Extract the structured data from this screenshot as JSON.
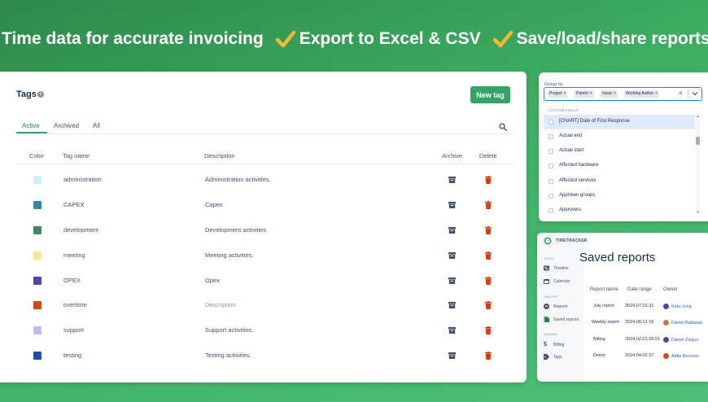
{
  "headline": {
    "item1": "Time data for accurate invoicing",
    "item2": "Export to Excel & CSV",
    "item3": "Save/load/share reports"
  },
  "colors": {
    "accent": "#36a466",
    "check": "#f5b82e",
    "delete": "#de350b",
    "archive": "#42526e"
  },
  "tags": {
    "title": "Tags",
    "new_button": "New tag",
    "tabs": [
      "Active",
      "Archived",
      "All"
    ],
    "columns": {
      "color": "Color",
      "name": "Tag name",
      "description": "Description",
      "archive": "Archive",
      "delete": "Delete"
    },
    "rows": [
      {
        "color": "#c9f2f7",
        "name": "administration",
        "description": "Administration activities."
      },
      {
        "color": "#2e8c9f",
        "name": "CAPEX",
        "description": "Capex"
      },
      {
        "color": "#3d8a5c",
        "name": "development",
        "description": "Development activities."
      },
      {
        "color": "#fde38b",
        "name": "meeting",
        "description": "Meeting activities."
      },
      {
        "color": "#5243aa",
        "name": "OPEX",
        "description": "Opex"
      },
      {
        "color": "#d9440f",
        "name": "overtime",
        "description": "Description"
      },
      {
        "color": "#c4b8f0",
        "name": "support",
        "description": "Support activities."
      },
      {
        "color": "#1f4fa8",
        "name": "testing",
        "description": "Testing activities."
      }
    ]
  },
  "group_by": {
    "label": "Group by",
    "chips": [
      "Project",
      "Parent",
      "Issue",
      "Worklog Author"
    ],
    "section": "CUSTOM FIELDS",
    "options": [
      "[CHART] Date of First Response",
      "Actual end",
      "Actual start",
      "Affected hardware",
      "Affected services",
      "Approver groups",
      "Approvers"
    ]
  },
  "saved_reports": {
    "brand": "TIMETRACKER",
    "title": "Saved reports",
    "nav": {
      "track": "TRACK",
      "timeline": "Timeline",
      "calendar": "Calendar",
      "analyze": "ANALYZE",
      "reports": "Reports",
      "saved": "Saved reports",
      "manage": "MANAGE",
      "billing": "Billing",
      "tags": "Tags"
    },
    "columns": [
      "Report name",
      "Date range",
      "Owner"
    ],
    "rows": [
      {
        "name": "July report",
        "range": "2024.07.01-31",
        "owner": "Kata Jung",
        "avatar": "#5243aa"
      },
      {
        "name": "Weekly report",
        "range": "2024.08.12-16",
        "owner": "Dániel Ballabás",
        "avatar": "#c9734a"
      },
      {
        "name": "Billing",
        "range": "2024.02.01-05.01",
        "owner": "Dániel Zsigus",
        "avatar": "#5243aa"
      },
      {
        "name": "Demo",
        "range": "2024.04.02-27",
        "owner": "Attila Borcsós",
        "avatar": "#d9440f"
      }
    ]
  }
}
